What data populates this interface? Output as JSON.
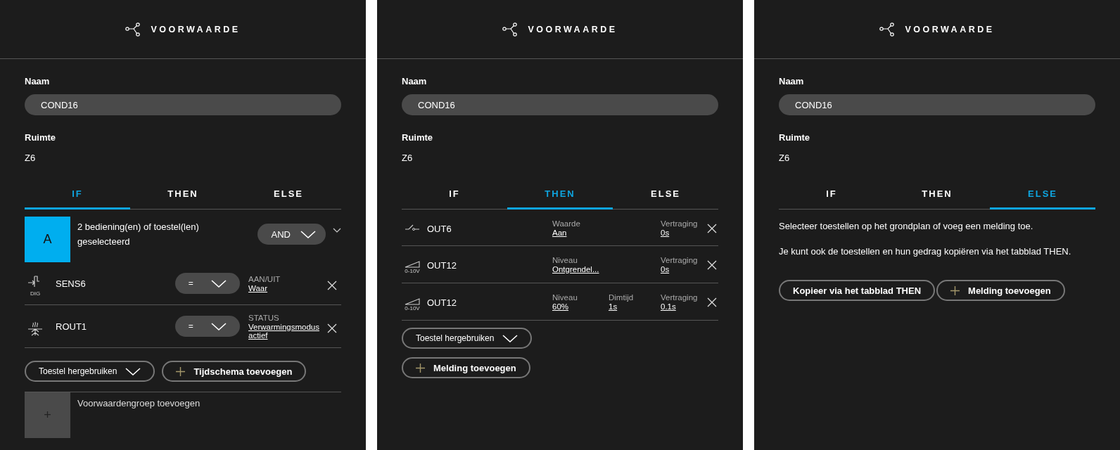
{
  "panels": [
    {
      "kind": "if",
      "title": "VOORWAARDE",
      "name_label": "Naam",
      "name_value": "COND16",
      "room_label": "Ruimte",
      "room_value": "Z6",
      "tabs": [
        {
          "label": "IF",
          "selected": true
        },
        {
          "label": "THEN",
          "selected": false
        },
        {
          "label": "ELSE",
          "selected": false
        }
      ],
      "group": {
        "letter": "A",
        "text": "2 bediening(en) of toestel(len) geselecteerd",
        "operator": "AND"
      },
      "conditions": [
        {
          "kind": "sensor",
          "icon_caption": "DIG",
          "name": "SENS6",
          "operator": "=",
          "label": "AAN/UIT",
          "value": "Waar"
        },
        {
          "kind": "heating",
          "name": "ROUT1",
          "operator": "=",
          "label": "STATUS",
          "value": "Verwarmingsmodus actief"
        }
      ],
      "reuse_button": "Toestel hergebruiken",
      "add_button": "Tijdschema toevoegen",
      "add_group": {
        "icon": "+",
        "label": "Voorwaardengroep toevoegen"
      }
    },
    {
      "kind": "then",
      "title": "VOORWAARDE",
      "name_label": "Naam",
      "name_value": "COND16",
      "room_label": "Ruimte",
      "room_value": "Z6",
      "tabs": [
        {
          "label": "IF",
          "selected": false
        },
        {
          "label": "THEN",
          "selected": true
        },
        {
          "label": "ELSE",
          "selected": false
        }
      ],
      "actions": [
        {
          "kind": "switch",
          "name": "OUT6",
          "params": [
            {
              "label": "Waarde",
              "value": "Aan"
            }
          ],
          "delay_label": "Vertraging",
          "delay": "0s"
        },
        {
          "kind": "dimmer",
          "icon_caption": "0-10V",
          "name": "OUT12",
          "params": [
            {
              "label": "Niveau",
              "value": "Ontgrendel..."
            }
          ],
          "delay_label": "Vertraging",
          "delay": "0s"
        },
        {
          "kind": "dimmer",
          "icon_caption": "0-10V",
          "name": "OUT12",
          "params": [
            {
              "label": "Niveau",
              "value": "60%"
            },
            {
              "label": "Dimtijd",
              "value": "1s"
            }
          ],
          "delay_label": "Vertraging",
          "delay": "0.1s"
        }
      ],
      "reuse_button": "Toestel hergebruiken",
      "add_button": "Melding toevoegen"
    },
    {
      "kind": "else",
      "title": "VOORWAARDE",
      "name_label": "Naam",
      "name_value": "COND16",
      "room_label": "Ruimte",
      "room_value": "Z6",
      "tabs": [
        {
          "label": "IF",
          "selected": false
        },
        {
          "label": "THEN",
          "selected": false
        },
        {
          "label": "ELSE",
          "selected": true
        }
      ],
      "paragraphs": [
        "Selecteer toestellen op het grondplan of voeg een melding toe.",
        "Je kunt ook de toestellen en hun gedrag kopiëren via het tabblad THEN."
      ],
      "copy_button": "Kopieer via het tabblad THEN",
      "add_button": "Melding toevoegen"
    }
  ]
}
